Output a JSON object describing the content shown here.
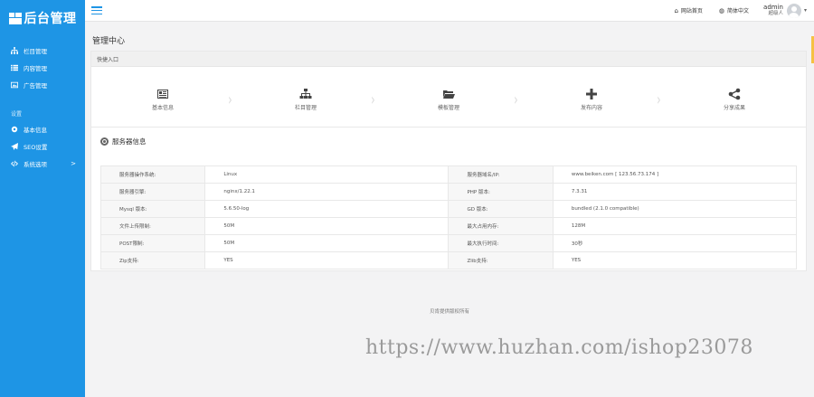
{
  "app": {
    "logo_text": "后台管理"
  },
  "sidebar": {
    "items": [
      {
        "label": "栏目管理",
        "icon": "sitemap-icon"
      },
      {
        "label": "内容管理",
        "icon": "list-icon"
      },
      {
        "label": "广告管理",
        "icon": "image-icon"
      }
    ],
    "group_title": "设置",
    "settings_items": [
      {
        "label": "基本信息",
        "icon": "gear-icon"
      },
      {
        "label": "SEO设置",
        "icon": "paper-plane-icon"
      },
      {
        "label": "系统选项",
        "icon": "code-icon",
        "arrow": ">"
      }
    ]
  },
  "topbar": {
    "site_home": "网站首页",
    "language": "简体中文",
    "user_name": "admin",
    "user_role": "超级人",
    "caret": "▾"
  },
  "page": {
    "title": "管理中心"
  },
  "quick_entry": {
    "header": "快捷入口",
    "items": [
      {
        "label": "基本信息",
        "icon": "newspaper-icon"
      },
      {
        "label": "栏目管理",
        "icon": "sitemap-icon"
      },
      {
        "label": "模板管理",
        "icon": "folder-open-icon"
      },
      {
        "label": "发布内容",
        "icon": "plus-icon"
      },
      {
        "label": "分享成果",
        "icon": "share-icon"
      }
    ]
  },
  "server_info": {
    "title": "服务器信息",
    "rows": [
      [
        "服务器操作系统:",
        "Linux",
        "服务器域名/IP:",
        "www.beiken.com [ 123.56.73.174 ]"
      ],
      [
        "服务器引擎:",
        "nginx/1.22.1",
        "PHP 版本:",
        "7.3.31"
      ],
      [
        "Mysql 版本:",
        "5.6.50-log",
        "GD 版本:",
        "bundled (2.1.0 compatible)"
      ],
      [
        "文件上传限制:",
        "50M",
        "最大占用内存:",
        "128M"
      ],
      [
        "POST限制:",
        "50M",
        "最大执行时间:",
        "30秒"
      ],
      [
        "Zip支持:",
        "YES",
        "Zlib支持:",
        "YES"
      ]
    ]
  },
  "footer": {
    "text": "贝肯提供版权所有"
  },
  "watermark": {
    "text": "https://www.huzhan.com/ishop23078"
  },
  "colors": {
    "sidebar": "#1e95e5",
    "accent_tab": "#f6c143"
  }
}
